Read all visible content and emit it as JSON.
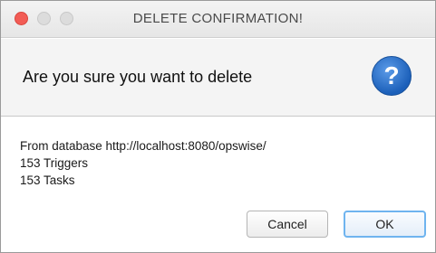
{
  "window": {
    "title": "DELETE CONFIRMATION!"
  },
  "header": {
    "question": "Are you sure you want to delete",
    "icon": "help-icon",
    "icon_glyph": "?",
    "icon_color": "#2a6fd1"
  },
  "content": {
    "lines": [
      "From database http://localhost:8080/opswise/",
      "153 Triggers",
      "153 Tasks"
    ]
  },
  "buttons": {
    "cancel_label": "Cancel",
    "ok_label": "OK"
  },
  "colors": {
    "close_button": "#f25c55",
    "default_button_focus": "#6fb4ef"
  }
}
